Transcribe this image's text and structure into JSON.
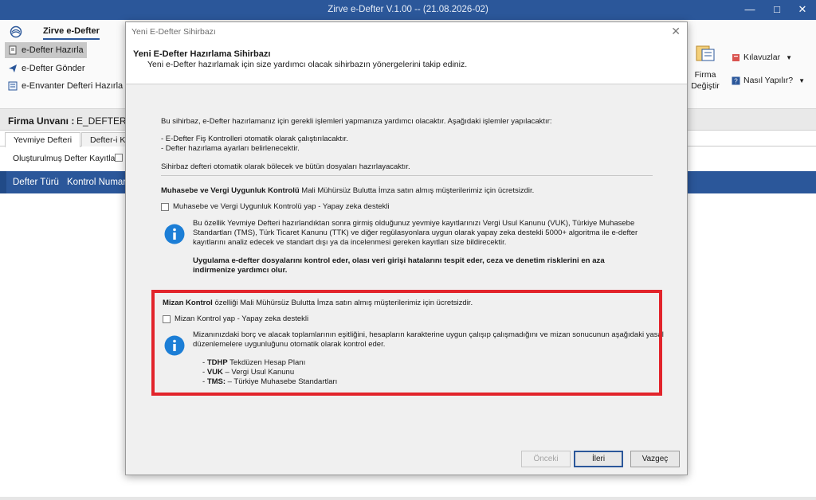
{
  "window": {
    "title": "Zirve e-Defter V.1.00  -- (21.08.2026-02)"
  },
  "ribbon": {
    "tab": "Zirve e-Defter",
    "items": [
      "e-Defter Hazırla",
      "e-Defter Gönder",
      "e-Envanter Defteri Hazırla"
    ],
    "firma_line1": "Firma",
    "firma_line2": "Değiştir",
    "kilavuzlar": "Kılavuzlar",
    "nasil": "Nasıl Yapılır?"
  },
  "firma": {
    "label": "Firma Unvanı :",
    "value": "E_DEFTER"
  },
  "tabs": [
    "Yevmiye Defteri",
    "Defter-i K"
  ],
  "filter": {
    "label": "Oluşturulmuş Defter Kayıtları"
  },
  "grid": {
    "columns": [
      "Defter Türü",
      "Kontrol Numara"
    ]
  },
  "dialog": {
    "title": "Yeni E-Defter Sihirbazı",
    "header_title": "Yeni E-Defter Hazırlama Sihirbazı",
    "header_subtitle": "Yeni e-Defter hazırlamak için size yardımcı olacak sihirbazın yönergelerini takip ediniz.",
    "intro": "Bu sihirbaz, e-Defter hazırlamanız için gerekli işlemleri yapmanıza yardımcı olacaktır. Aşağıdaki işlemler yapılacaktır:",
    "bullet1": "- E-Defter Fiş Kontrolleri otomatik olarak çalıştırılacaktır.",
    "bullet2": "- Defter hazırlama ayarları belirlenecektir.",
    "split_note": "Sihirbaz defteri otomatik olarak bölecek ve bütün dosyaları hazırlayacaktır.",
    "section1": {
      "title_bold": "Muhasebe ve Vergi Uygunluk Kontrolü",
      "title_rest": " Mali Mühürsüz Bulutta İmza satın almış müşterilerimiz için ücretsizdir.",
      "checkbox": "Muhasebe ve Vergi Uygunluk Kontrolü yap - Yapay zeka destekli",
      "info_line1": "Bu özellik Yevmiye Defteri hazırlandıktan sonra girmiş olduğunuz yevmiye kayıtlarınızı Vergi Usul Kanunu (VUK), Türkiye Muhasebe",
      "info_line2": "Standartları (TMS), Türk Ticaret Kanunu (TTK) ve diğer regülasyonlara uygun olarak yapay zeka destekli 5000+ algoritma ile e-defter",
      "info_line3": "kayıtlarını analiz edecek ve standart dışı ya da incelenmesi gereken kayıtları size bildirecektir.",
      "bold_line1": "Uygulama e-defter dosyalarını kontrol eder, olası veri girişi hatalarını tespit eder, ceza ve denetim risklerini en aza",
      "bold_line2": "indirmenize yardımcı olur."
    },
    "section2": {
      "title_bold": "Mizan Kontrol",
      "title_rest": " özelliği Mali Mühürsüz Bulutta İmza satın almış müşterilerimiz için ücretsizdir.",
      "checkbox": "Mizan Kontrol yap - Yapay zeka destekli",
      "info_line1": "Mizanınızdaki borç ve alacak toplamlarının eşitliğini, hesapların karakterine uygun çalışıp çalışmadığını ve mizan sonucunun aşağıdaki yasal",
      "info_line2": "düzenlemelere uygunluğunu otomatik olarak kontrol eder.",
      "list": [
        {
          "code": "TDHP",
          "text": " Tekdüzen Hesap Planı"
        },
        {
          "code": "VUK",
          "text": " – Vergi Usul Kanunu"
        },
        {
          "code": "TMS:",
          "text": " – Türkiye Muhasebe Standartları"
        }
      ]
    },
    "buttons": {
      "back": "Önceki",
      "next": "İleri",
      "cancel": "Vazgeç"
    }
  },
  "colors": {
    "brand_blue": "#2b579a",
    "highlight_red": "#e2242b",
    "info_blue": "#1c7ed6"
  }
}
